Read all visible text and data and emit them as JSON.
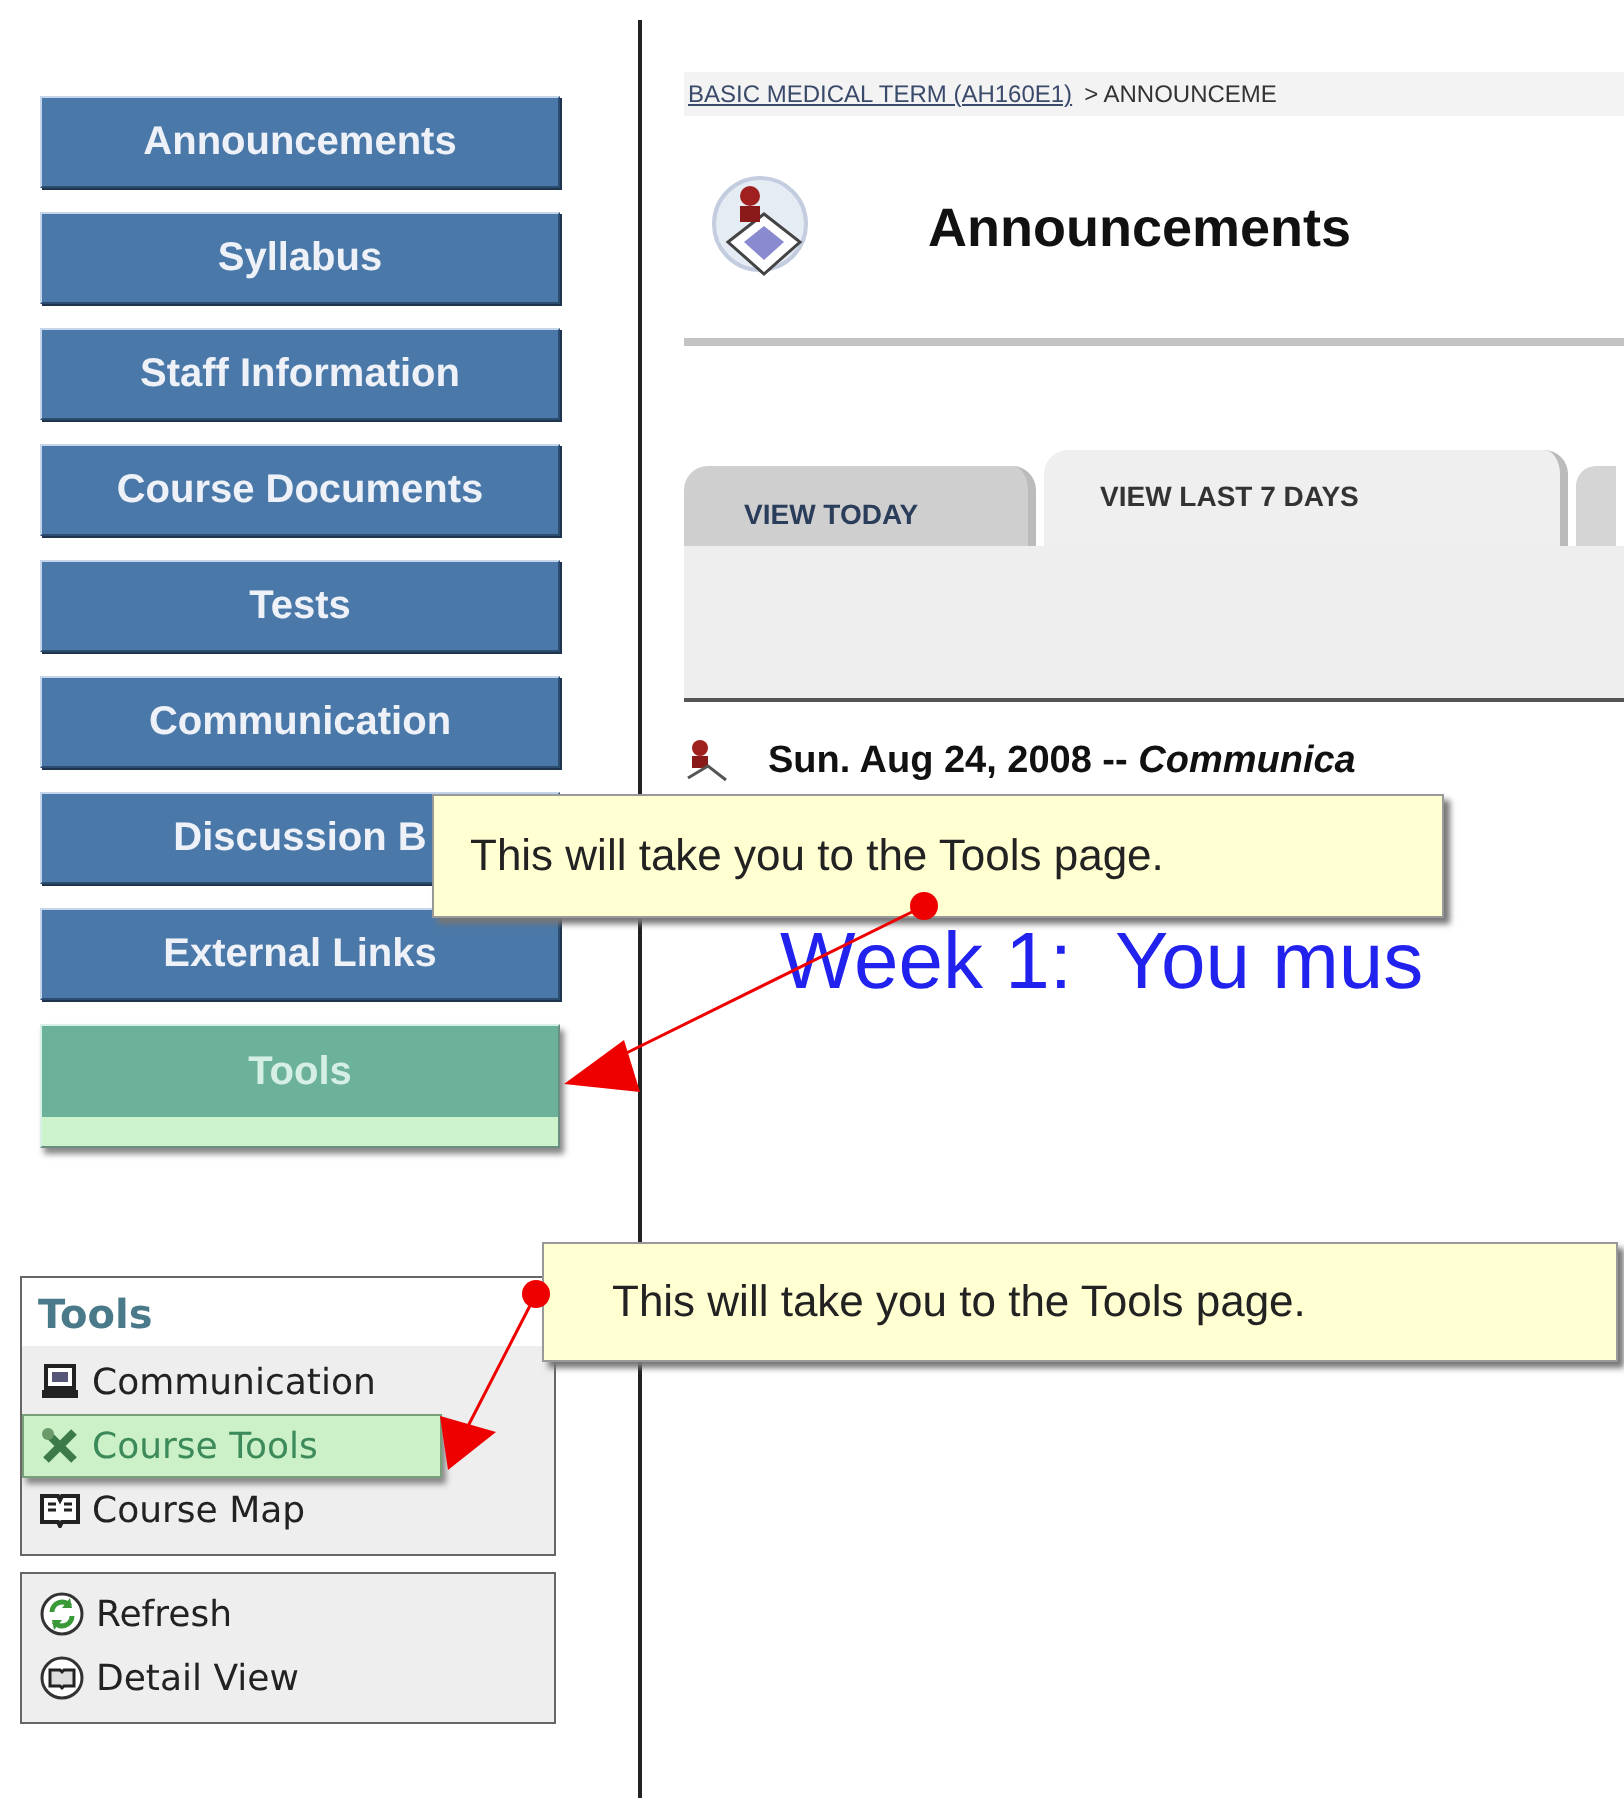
{
  "nav_buttons": [
    {
      "label": "Announcements",
      "selected": false
    },
    {
      "label": "Syllabus",
      "selected": false
    },
    {
      "label": "Staff Information",
      "selected": false
    },
    {
      "label": "Course Documents",
      "selected": false
    },
    {
      "label": "Tests",
      "selected": false
    },
    {
      "label": "Communication",
      "selected": false
    },
    {
      "label": "Discussion B",
      "selected": false
    },
    {
      "label": "External Links",
      "selected": false
    },
    {
      "label": "Tools",
      "selected": true
    }
  ],
  "tools_panel": {
    "title": "Tools",
    "items": [
      {
        "label": "Communication",
        "kind": "computer",
        "selected": false
      },
      {
        "label": "Course Tools",
        "kind": "tools",
        "selected": true
      },
      {
        "label": "Course Map",
        "kind": "book",
        "selected": false
      }
    ]
  },
  "view_panel": {
    "items": [
      {
        "label": "Refresh",
        "kind": "refresh"
      },
      {
        "label": "Detail View",
        "kind": "detail"
      }
    ]
  },
  "breadcrumb": {
    "link": "BASIC MEDICAL TERM (AH160E1)",
    "current": "> ANNOUNCEME"
  },
  "page_title": "Announcements",
  "tabs": [
    {
      "label": "VIEW TODAY",
      "selected": false
    },
    {
      "label": "VIEW LAST 7 DAYS",
      "selected": true
    }
  ],
  "announcement": {
    "date": "Sun. Aug 24, 2008 --",
    "category": "Communica",
    "body": "Week 1:  You mus"
  },
  "callouts": [
    {
      "text": "This will take you to the Tools page."
    },
    {
      "text": "This will take you to the Tools page."
    }
  ]
}
